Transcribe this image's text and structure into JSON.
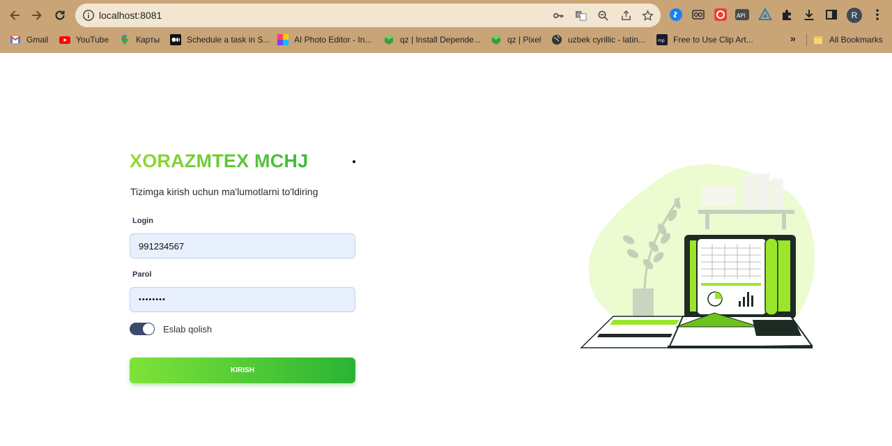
{
  "browser": {
    "url": "localhost:8081",
    "profile_initial": "R",
    "ext_api_label": "API",
    "bookmarks": [
      {
        "label": "Gmail",
        "icon": "gmail-icon"
      },
      {
        "label": "YouTube",
        "icon": "youtube-icon"
      },
      {
        "label": "Карты",
        "icon": "maps-icon"
      },
      {
        "label": "Schedule a task in S...",
        "icon": "medium-icon"
      },
      {
        "label": "AI Photo Editor - In...",
        "icon": "photo-editor-icon"
      },
      {
        "label": "qz | Install Depende...",
        "icon": "qz-icon"
      },
      {
        "label": "qz | Pixel",
        "icon": "qz-icon"
      },
      {
        "label": "uzbek cyrillic - latin...",
        "icon": "globe-icon"
      },
      {
        "label": "Free to Use Clip Art...",
        "icon": "clipart-icon"
      }
    ],
    "more_label": "»",
    "all_bookmarks_label": "All Bookmarks"
  },
  "login": {
    "brand": "XORAZMTEX MCHJ",
    "subtitle": "Tizimga kirish uchun ma'lumotlarni to'ldiring",
    "login_label": "Login",
    "login_value": "991234567",
    "password_label": "Parol",
    "password_value": "••••••••",
    "remember_label": "Eslab qolish",
    "remember_checked": true,
    "submit_label": "KIRISH"
  },
  "colors": {
    "chrome": "#c9a477",
    "brand_start": "#9ad934",
    "brand_end": "#38bb3a",
    "toggle": "#3b4a6b"
  }
}
